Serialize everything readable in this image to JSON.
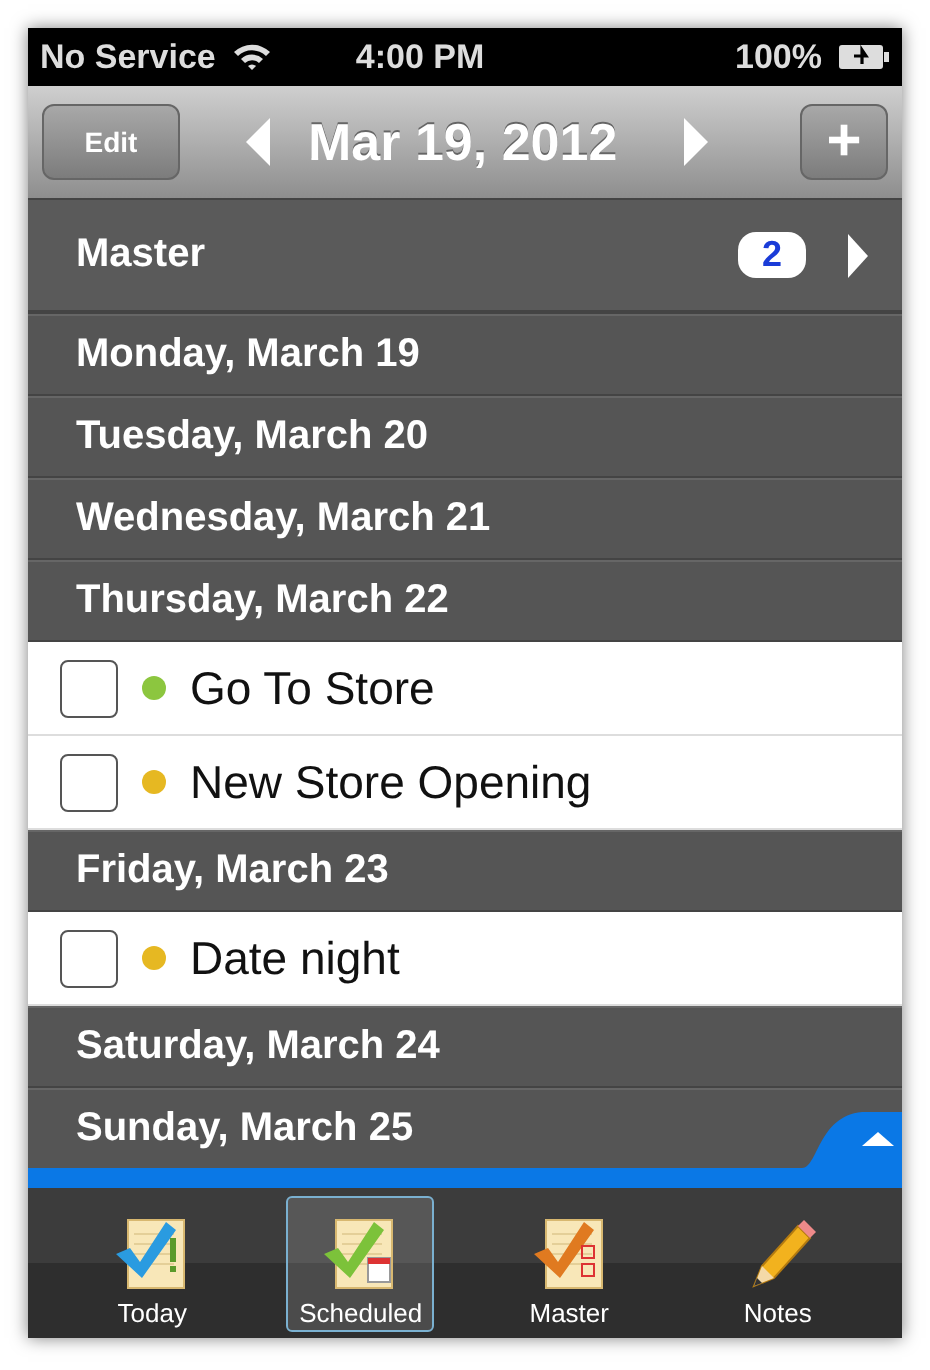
{
  "status_bar": {
    "carrier": "No Service",
    "time": "4:00 PM",
    "battery": "100%"
  },
  "nav_bar": {
    "edit_button": "Edit",
    "title": "Mar 19, 2012",
    "add_button": "+"
  },
  "master_row": {
    "label": "Master",
    "count": "2"
  },
  "rows": [
    {
      "kind": "day",
      "label": "Monday, March 19"
    },
    {
      "kind": "day",
      "label": "Tuesday, March 20"
    },
    {
      "kind": "day",
      "label": "Wednesday, March 21"
    },
    {
      "kind": "day",
      "label": "Thursday, March 22"
    },
    {
      "kind": "task",
      "label": "Go To Store",
      "checked": false,
      "color": "#8cc63f"
    },
    {
      "kind": "task",
      "label": "New Store Opening",
      "checked": false,
      "color": "#e6b822"
    },
    {
      "kind": "day",
      "label": "Friday, March 23"
    },
    {
      "kind": "task",
      "label": "Date night",
      "checked": false,
      "color": "#e6b822"
    },
    {
      "kind": "day",
      "label": "Saturday, March 24"
    },
    {
      "kind": "day",
      "label": "Sunday, March 25"
    }
  ],
  "tabs": [
    {
      "label": "Today",
      "selected": false,
      "kind": "today"
    },
    {
      "label": "Scheduled",
      "selected": true,
      "kind": "scheduled"
    },
    {
      "label": "Master",
      "selected": false,
      "kind": "master"
    },
    {
      "label": "Notes",
      "selected": false,
      "kind": "notes"
    }
  ]
}
